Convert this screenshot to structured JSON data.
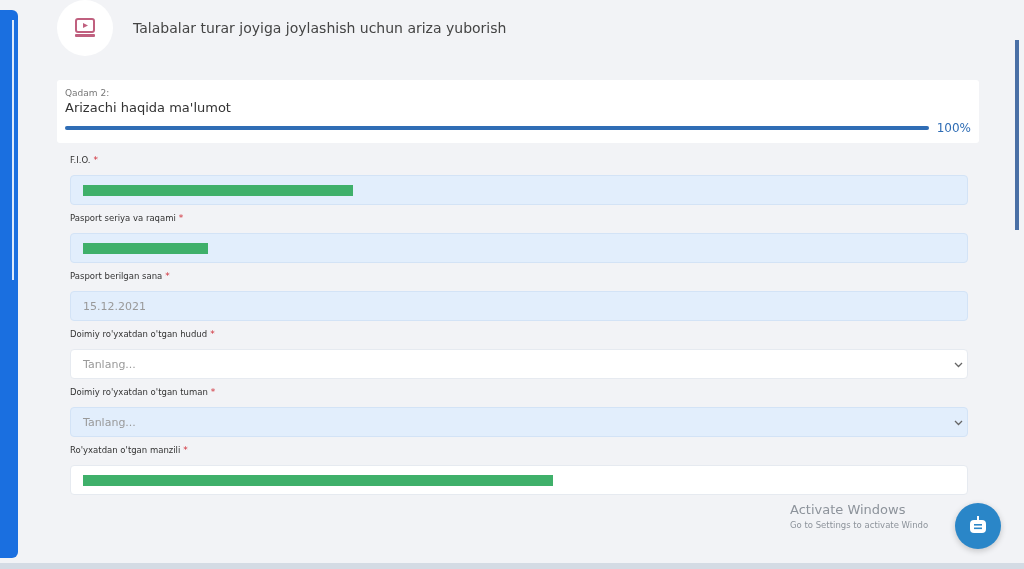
{
  "header": {
    "title": "Talabalar turar joyiga joylashish uchun ariza yuborish"
  },
  "step": {
    "caption": "Qadam 2:",
    "title": "Arizachi haqida ma'lumot",
    "level": 1,
    "percent": "100%"
  },
  "fields": [
    {
      "label": "F.I.O.",
      "required_mark": "*",
      "kind": "input",
      "redacted": true,
      "autofilled": true
    },
    {
      "label": "Pasport seriya va raqami",
      "required_mark": "*",
      "kind": "input",
      "redacted": true,
      "autofilled": true
    },
    {
      "label": "Pasport berilgan sana",
      "required_mark": "*",
      "kind": "input",
      "value": "15.12.2021",
      "redacted": false,
      "autofilled": true
    },
    {
      "label": "Doimiy ro'yxatdan o'tgan hudud",
      "required_mark": "*",
      "kind": "select",
      "placeholder": "Tanlang...",
      "redacted": false,
      "autofilled": false
    },
    {
      "label": "Doimiy ro'yxatdan o'tgan tuman",
      "required_mark": "*",
      "kind": "select",
      "placeholder": "Tanlang...",
      "redacted": false,
      "autofilled": true
    },
    {
      "label": "Ro'yxatdan o'tgan manzili",
      "required_mark": "*",
      "kind": "input",
      "redacted": true,
      "autofilled": false
    }
  ],
  "activation_notice": {
    "title": "Activate Windows",
    "subtitle": "Go to Settings to activate Windo"
  }
}
